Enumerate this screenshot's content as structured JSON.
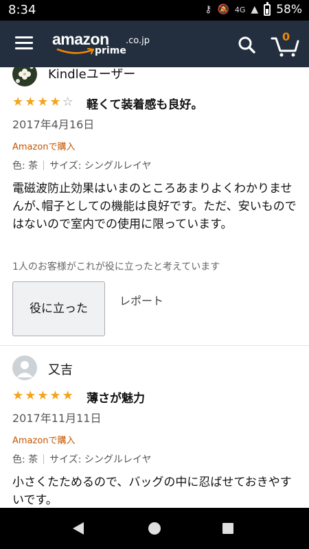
{
  "status_bar": {
    "time": "8:34",
    "network": "4G",
    "battery": "58%"
  },
  "header": {
    "logo_word": "amazon",
    "logo_domain": ".co.jp",
    "logo_prime": "prime",
    "cart_count": "0",
    "brand_color": "#232f3e",
    "accent_color": "#f08804"
  },
  "reviews": [
    {
      "reviewer": "Kindleユーザー",
      "avatar": "flower-avatar",
      "rating": 4,
      "title": "軽くて装着感も良好。",
      "date": "2017年4月16日",
      "purchase": "Amazonで購入",
      "color": "色: 茶",
      "size": "サイズ: シングルレイヤ",
      "body": "電磁波防止効果はいまのところあまりよくわかりませんが､帽子としての機能は良好です。ただ、安いものではないので室内での使用に限っています。",
      "helpful_count_text": "1人のお客様がこれが役に立ったと考えています",
      "helpful_button": "役に立った",
      "report_link": "レポート"
    },
    {
      "reviewer": "又吉",
      "avatar": "default-user-avatar",
      "rating": 5,
      "title": "薄さが魅力",
      "date": "2017年11月11日",
      "purchase": "Amazonで購入",
      "color": "色: 茶",
      "size": "サイズ: シングルレイヤ",
      "body": "小さくたためるので、バッグの中に忍ばせておきやすいです。"
    }
  ],
  "colors": {
    "star": "#f4a41a",
    "purchase_label": "#c45500"
  }
}
